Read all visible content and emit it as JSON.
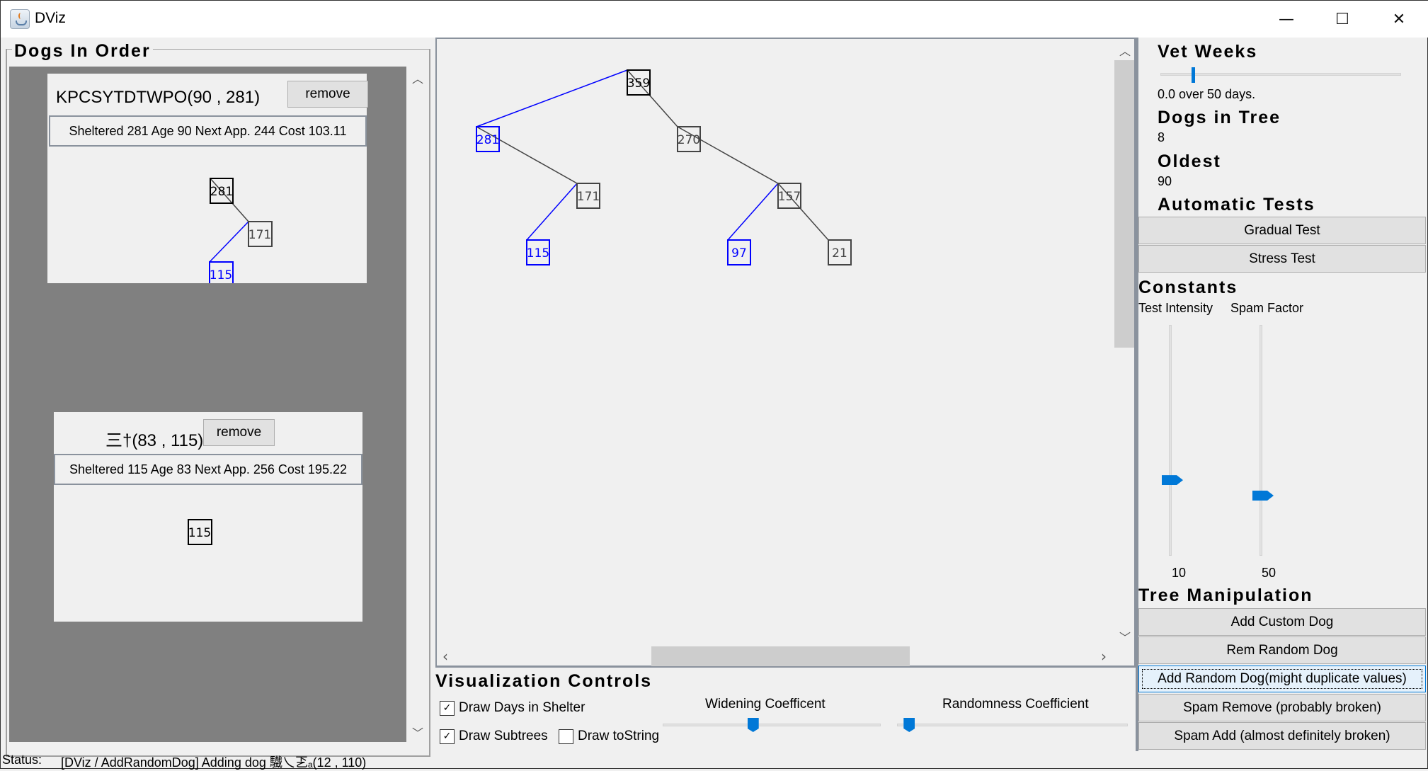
{
  "window": {
    "title": "DViz",
    "controls": {
      "minimize": "—",
      "maximize": "☐",
      "close": "✕"
    }
  },
  "left_panel": {
    "title": "Dogs In Order",
    "cards": [
      {
        "name": "KPCSYTDTWPO(90 , 281)",
        "remove_label": "remove",
        "stats": "Sheltered 281  Age 90  Next App. 244  Cost 103.11",
        "subtree": {
          "nodes": [
            {
              "id": "a",
              "label": "281",
              "color": "#000000"
            },
            {
              "id": "b",
              "label": "171",
              "color": "#444444"
            },
            {
              "id": "c",
              "label": "115",
              "color": "#0000ff"
            }
          ]
        }
      },
      {
        "name": "三†(83 , 115)",
        "remove_label": "remove",
        "stats": "Sheltered 115  Age 83  Next App. 256  Cost 195.22",
        "subtree": {
          "nodes": [
            {
              "id": "a",
              "label": "115",
              "color": "#000000"
            }
          ]
        }
      }
    ]
  },
  "tree_view": {
    "nodes": [
      {
        "id": "n359",
        "label": "359",
        "color": "#000000"
      },
      {
        "id": "n281",
        "label": "281",
        "color": "#0000ff"
      },
      {
        "id": "n270",
        "label": "270",
        "color": "#444444"
      },
      {
        "id": "n171",
        "label": "171",
        "color": "#444444"
      },
      {
        "id": "n115",
        "label": "115",
        "color": "#0000ff"
      },
      {
        "id": "n157",
        "label": "157",
        "color": "#444444"
      },
      {
        "id": "n97",
        "label": "97",
        "color": "#0000ff"
      },
      {
        "id": "n21",
        "label": "21",
        "color": "#444444"
      }
    ],
    "edges": [
      {
        "from": "n359",
        "to": "n281",
        "side": "left"
      },
      {
        "from": "n359",
        "to": "n270",
        "side": "right"
      },
      {
        "from": "n281",
        "to": "n171",
        "side": "right"
      },
      {
        "from": "n171",
        "to": "n115",
        "side": "left"
      },
      {
        "from": "n270",
        "to": "n157",
        "side": "right"
      },
      {
        "from": "n157",
        "to": "n97",
        "side": "left"
      },
      {
        "from": "n157",
        "to": "n21",
        "side": "right"
      }
    ],
    "left_edge_color": "#0000ff",
    "right_edge_color": "#444444"
  },
  "viz_controls": {
    "title": "Visualization Controls",
    "checkboxes": [
      {
        "label": "Draw Days in Shelter",
        "checked": true
      },
      {
        "label": "Draw Subtrees",
        "checked": true
      },
      {
        "label": "Draw toString",
        "checked": false
      }
    ],
    "sliders": [
      {
        "label": "Widening Coefficent",
        "value_fraction": 0.41
      },
      {
        "label": "Randomness Coefficient",
        "value_fraction": 0.03
      }
    ]
  },
  "right_panel": {
    "vet_weeks": {
      "title": "Vet Weeks",
      "value_fraction": 0.13,
      "text": "0.0 over 50 days."
    },
    "dogs_in_tree": {
      "title": "Dogs in Tree",
      "value": "8"
    },
    "oldest": {
      "title": "Oldest",
      "value": "90"
    },
    "automatic_tests": {
      "title": "Automatic Tests",
      "buttons": [
        "Gradual Test",
        "Stress Test"
      ]
    },
    "constants": {
      "title": "Constants",
      "sliders": [
        {
          "label": "Test Intensity",
          "value": "10",
          "value_fraction": 0.32
        },
        {
          "label": "Spam Factor",
          "value": "50",
          "value_fraction": 0.25
        }
      ]
    },
    "tree_manipulation": {
      "title": "Tree Manipulation",
      "buttons": [
        "Add Custom Dog",
        "Rem Random Dog",
        "Add Random Dog(might duplicate values)",
        "Spam Remove (probably broken)",
        "Spam Add (almost definitely broken)"
      ],
      "focused_index": 2
    }
  },
  "status": {
    "label": "Status:",
    "text": "[DViz / AddRandomDog] Adding dog 驖乀乤ₐ(12 , 110)"
  },
  "accent_color": "#0078d7"
}
